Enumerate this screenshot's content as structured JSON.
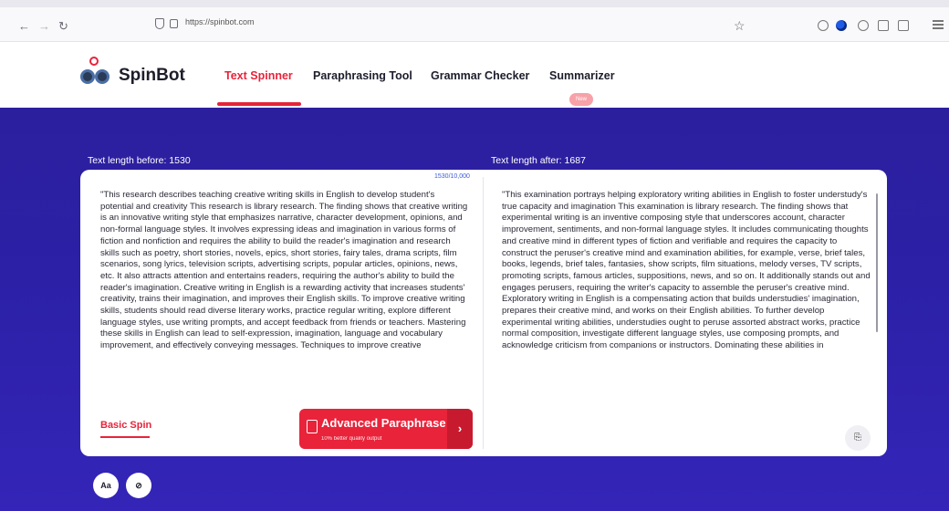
{
  "browser": {
    "back": "←",
    "forward": "→",
    "reload": "↻",
    "url": "https://spinbot.com",
    "star": "☆",
    "icons": [
      "pocket-icon",
      "firefox-account-icon",
      "extension-icon",
      "share-icon",
      "extensions-puzzle-icon",
      "menu-icon"
    ]
  },
  "header": {
    "brand": "SpinBot",
    "nav": [
      "Text Spinner",
      "Paraphrasing Tool",
      "Grammar Checker",
      "Summarizer"
    ],
    "new_badge": "New"
  },
  "main": {
    "len_before": "Text length before: 1530",
    "len_after": "Text length after: 1687",
    "counter": "1530/10,000",
    "input_text": "\"This research describes teaching creative writing skills in English to develop student's potential and creativity This research is library research. The finding shows that creative writing is an innovative writing style that emphasizes narrative, character development, opinions, and non-formal language styles. It involves expressing ideas and imagination in various forms of fiction and nonfiction and requires the ability to build the reader's imagination and research skills such as poetry, short stories, novels, epics, short stories, fairy tales, drama scripts, film scenarios, song lyrics, television scripts, advertising scripts, popular articles, opinions, news, etc. It also attracts attention and entertains readers, requiring the author's ability to build the reader's imagination. Creative writing in English is a rewarding activity that increases students' creativity, trains their imagination, and improves their English skills. To improve creative writing skills, students should read diverse literary works, practice regular writing, explore different language styles, use writing prompts, and accept feedback from friends or teachers. Mastering these skills in English can lead to self-expression, imagination, language and vocabulary improvement, and effectively conveying messages. Techniques to improve creative",
    "output_text": "\"This examination portrays helping exploratory writing abilities in English to foster understudy's true capacity and imagination This examination is library research. The finding shows that experimental writing is an inventive composing style that underscores account, character improvement, sentiments, and non-formal language styles. It includes communicating thoughts and creative mind in different types of fiction and verifiable and requires the capacity to construct the peruser's creative mind and examination abilities, for example, verse, brief tales, books, legends, brief tales, fantasies, show scripts, film situations, melody verses, TV scripts, promoting scripts, famous articles, suppositions, news, and so on. It additionally stands out and engages perusers, requiring the writer's capacity to assemble the peruser's creative mind. Exploratory writing in English is a compensating action that builds understudies' imagination, prepares their creative mind, and works on their English abilities. To further develop experimental writing abilities, understudies ought to peruse assorted abstract works, practice normal composition, investigate different language styles, use composing prompts, and acknowledge criticism from companions or instructors. Dominating these abilities in",
    "basic_spin": "Basic Spin",
    "advanced_title": "Advanced Paraphrase",
    "advanced_sub": "10% better quality output",
    "advanced_arrow": "›",
    "copy": "⎘",
    "font_btn": "Aa",
    "clear_btn": "⊘"
  },
  "colors": {
    "accent": "#e8233a",
    "main_bg": "#2c1f9e",
    "counter": "#3a5bdc"
  }
}
